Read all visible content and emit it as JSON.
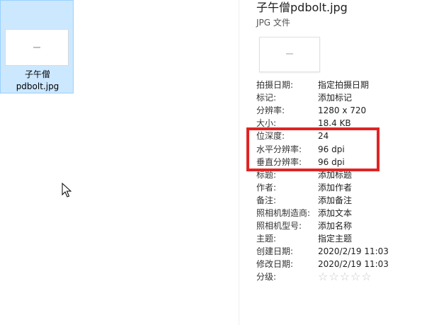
{
  "file_tile": {
    "name_line1": "子午僧",
    "name_line2": "pdbolt.jpg"
  },
  "details": {
    "title": "子午僧pdbolt.jpg",
    "file_type": "JPG 文件",
    "properties": [
      {
        "key": "拍摄日期:",
        "value": "指定拍摄日期"
      },
      {
        "key": "标记:",
        "value": "添加标记"
      },
      {
        "key": "分辨率:",
        "value": "1280 x 720"
      },
      {
        "key": "大小:",
        "value": "18.4 KB"
      },
      {
        "key": "位深度:",
        "value": "24"
      },
      {
        "key": "水平分辨率:",
        "value": "96 dpi"
      },
      {
        "key": "垂直分辨率:",
        "value": "96 dpi"
      },
      {
        "key": "标题:",
        "value": "添加标题"
      },
      {
        "key": "作者:",
        "value": "添加作者"
      },
      {
        "key": "备注:",
        "value": "添加备注"
      },
      {
        "key": "照相机制造商:",
        "value": "添加文本"
      },
      {
        "key": "照相机型号:",
        "value": "添加名称"
      },
      {
        "key": "主题:",
        "value": "指定主题"
      },
      {
        "key": "创建日期:",
        "value": "2020/2/19 11:03"
      },
      {
        "key": "修改日期:",
        "value": "2020/2/19 11:03"
      },
      {
        "key": "分级:",
        "value": ""
      }
    ],
    "rating": {
      "stars_total": 5,
      "stars_filled": 0
    }
  },
  "colors": {
    "selection_bg": "#cce8ff",
    "selection_border": "#99d1ff",
    "highlight": "#e02424"
  }
}
